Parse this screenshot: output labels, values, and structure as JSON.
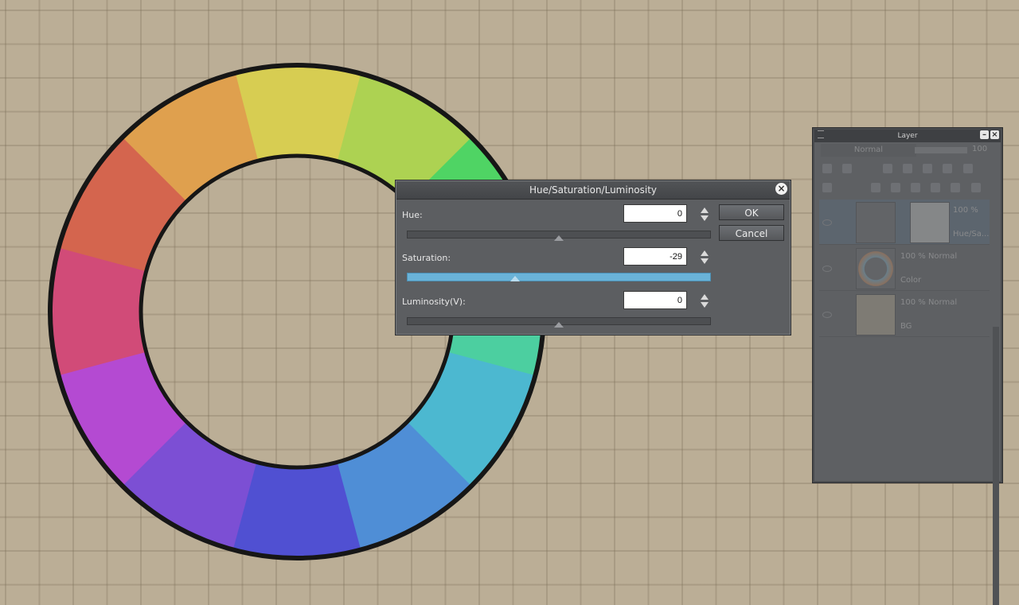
{
  "colors": {
    "wheel_segments": [
      "#d7cd52",
      "#add252",
      "#4fd464",
      "#4ccfa0",
      "#4cb8d0",
      "#4f8ed6",
      "#5050d2",
      "#7c4fd4",
      "#b44ad2",
      "#d14b78",
      "#d4654e",
      "#dfa04e"
    ]
  },
  "dialog": {
    "title": "Hue/Saturation/Luminosity",
    "close_icon": "close-icon",
    "hue": {
      "label": "Hue:",
      "value": "0",
      "slider_fraction": 0.5
    },
    "saturation": {
      "label": "Saturation:",
      "value": "-29",
      "slider_fraction": 0.355
    },
    "luminosity": {
      "label": "Luminosity(V):",
      "value": "0",
      "slider_fraction": 0.5
    },
    "ok_label": "OK",
    "cancel_label": "Cancel"
  },
  "layer_panel": {
    "title": "Layer",
    "blend_mode": "Normal",
    "opacity": "100",
    "layers": [
      {
        "mode": "100 %",
        "name": "Hue/Sa...",
        "selected": true,
        "thumb": "correction-icon"
      },
      {
        "mode": "100 % Normal",
        "name": "Color",
        "selected": false,
        "thumb": "color-wheel-icon"
      },
      {
        "mode": "100 % Normal",
        "name": "BG",
        "selected": false,
        "thumb": "paper-icon"
      }
    ]
  }
}
